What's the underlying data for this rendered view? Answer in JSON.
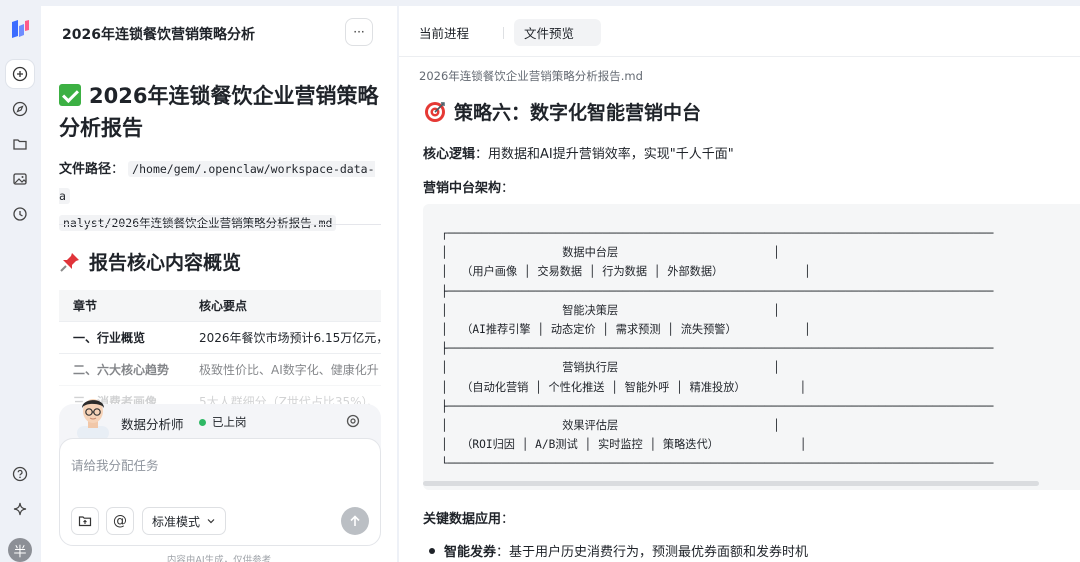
{
  "session": {
    "title": "2026年连锁餐饮营销策略分析",
    "more_label": "···"
  },
  "left_doc": {
    "h1": "2026年连锁餐饮企业营销策略分析报告",
    "path_label": "文件路径",
    "path_colon": "：",
    "path_part1": "/home/gem/.openclaw/workspace-data-a",
    "path_part2": "nalyst/2026年连锁餐饮企业营销策略分析报告.md",
    "h2": "报告核心内容概览",
    "table": {
      "headers": [
        "章节",
        "核心要点"
      ],
      "rows": [
        [
          "一、行业概览",
          "2026年餐饮市场预计6.15万亿元，"
        ],
        [
          "二、六大核心趋势",
          "极致性价比、AI数字化、健康化升"
        ],
        [
          "三、消费者画像",
          "5大人群细分（Z世代占比35%）、"
        ]
      ]
    }
  },
  "agent": {
    "name": "数据分析师",
    "status": "已上岗",
    "status_color": "#2fb865",
    "input_placeholder": "请给我分配任务",
    "mode_label": "标准模式",
    "at_label": "@",
    "footnote": "内容由AI生成，仅供参考"
  },
  "rail": {
    "avatar_label": "半",
    "icons": [
      "logo-icon",
      "new-chat-icon",
      "compass-icon",
      "folder-icon",
      "image-icon",
      "history-icon",
      "help-icon",
      "sparkle-icon"
    ]
  },
  "right": {
    "tabs": [
      "当前进程",
      "文件预览"
    ],
    "active_tab": "文件预览",
    "file_name": "2026年连锁餐饮企业营销策略分析报告.md",
    "h3": "策略六：数字化智能营销中台",
    "logic_label": "核心逻辑",
    "logic_text": "：用数据和AI提升营销效率，实现\"千人千面\"",
    "arch_label": "营销中台架构",
    "arch_colon": "：",
    "code": "┌─────────────────────────────────────────────────────────────────────────────────\n│                 数据中台层                       │\n│  （用户画像 │ 交易数据 │ 行为数据 │ 外部数据）            │\n├─────────────────────────────────────────────────────────────────────────────────\n│                 智能决策层                       │\n│  （AI推荐引擎 │ 动态定价 │ 需求预测 │ 流失预警）          │\n├─────────────────────────────────────────────────────────────────────────────────\n│                 营销执行层                       │\n│  （自动化营销 │ 个性化推送 │ 智能外呼 │ 精准投放）        │\n├─────────────────────────────────────────────────────────────────────────────────\n│                 效果评估层                       │\n│  （ROI归因 │ A/B测试 │ 实时监控 │ 策略迭代）            │\n└─────────────────────────────────────────────────────────────────────────────────",
    "apps_label": "关键数据应用",
    "apps_colon": "：",
    "bullet_label": "智能发券",
    "bullet_text": "：基于用户历史消费行为，预测最优券面额和发券时机"
  }
}
